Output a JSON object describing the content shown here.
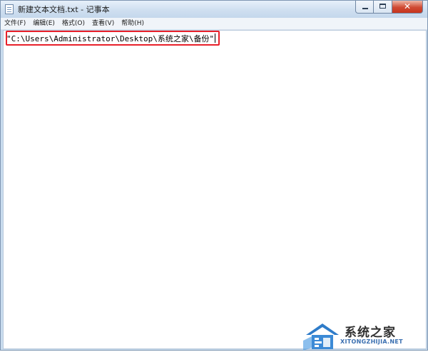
{
  "window": {
    "title": "新建文本文档.txt - 记事本"
  },
  "caption_buttons": {
    "close_glyph": "✕"
  },
  "menu": {
    "items": [
      {
        "label": "文件(F)",
        "name": "menu-file"
      },
      {
        "label": "编辑(E)",
        "name": "menu-edit"
      },
      {
        "label": "格式(O)",
        "name": "menu-format"
      },
      {
        "label": "查看(V)",
        "name": "menu-view"
      },
      {
        "label": "帮助(H)",
        "name": "menu-help"
      }
    ]
  },
  "editor": {
    "text": "\"C:\\Users\\Administrator\\Desktop\\系统之家\\备份\""
  },
  "watermark": {
    "name": "系统之家",
    "url": "XITONGZHIJIA.NET"
  },
  "colors": {
    "highlight_border": "#e8202a",
    "logo_blue": "#2f7cc9"
  }
}
